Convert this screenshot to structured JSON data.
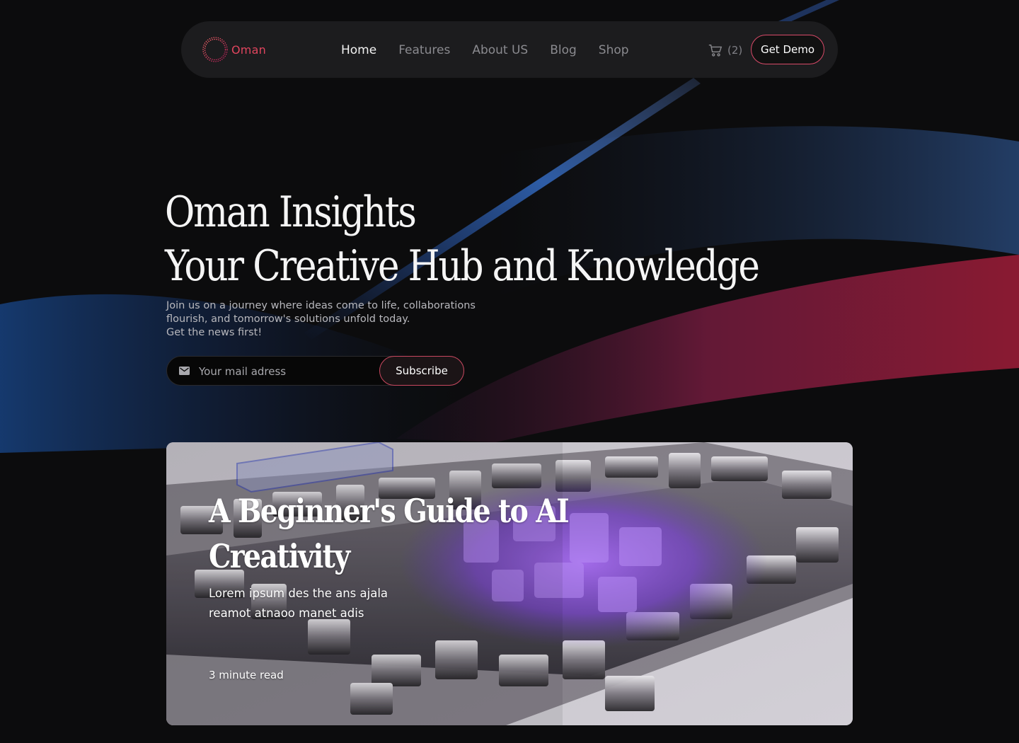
{
  "brand": {
    "name": "Oman",
    "accent": "#e0455e"
  },
  "nav": {
    "items": [
      {
        "label": "Home",
        "active": true
      },
      {
        "label": "Features",
        "active": false
      },
      {
        "label": "About US",
        "active": false
      },
      {
        "label": "Blog",
        "active": false
      },
      {
        "label": "Shop",
        "active": false
      }
    ],
    "cart_count": "(2)",
    "cta_label": "Get Demo"
  },
  "hero": {
    "title_line1": "Oman Insights",
    "title_line2": "Your Creative Hub and Knowledge",
    "subtitle_line1": "Join us on a journey where ideas come to life, collaborations",
    "subtitle_line2": "flourish, and tomorrow's solutions unfold today.",
    "subtitle_line3": "Get the news first!",
    "email_placeholder": "Your mail adress",
    "subscribe_label": "Subscribe"
  },
  "feature_card": {
    "title_line1": "A Beginner's Guide to AI",
    "title_line2": "Creativity",
    "desc_line1": "Lorem ipsum des the ans ajala",
    "desc_line2": "reamot atnaoo manet adis",
    "read_time": "3 minute read"
  },
  "icons": [
    "logo-icon",
    "cart-icon",
    "mail-icon"
  ]
}
